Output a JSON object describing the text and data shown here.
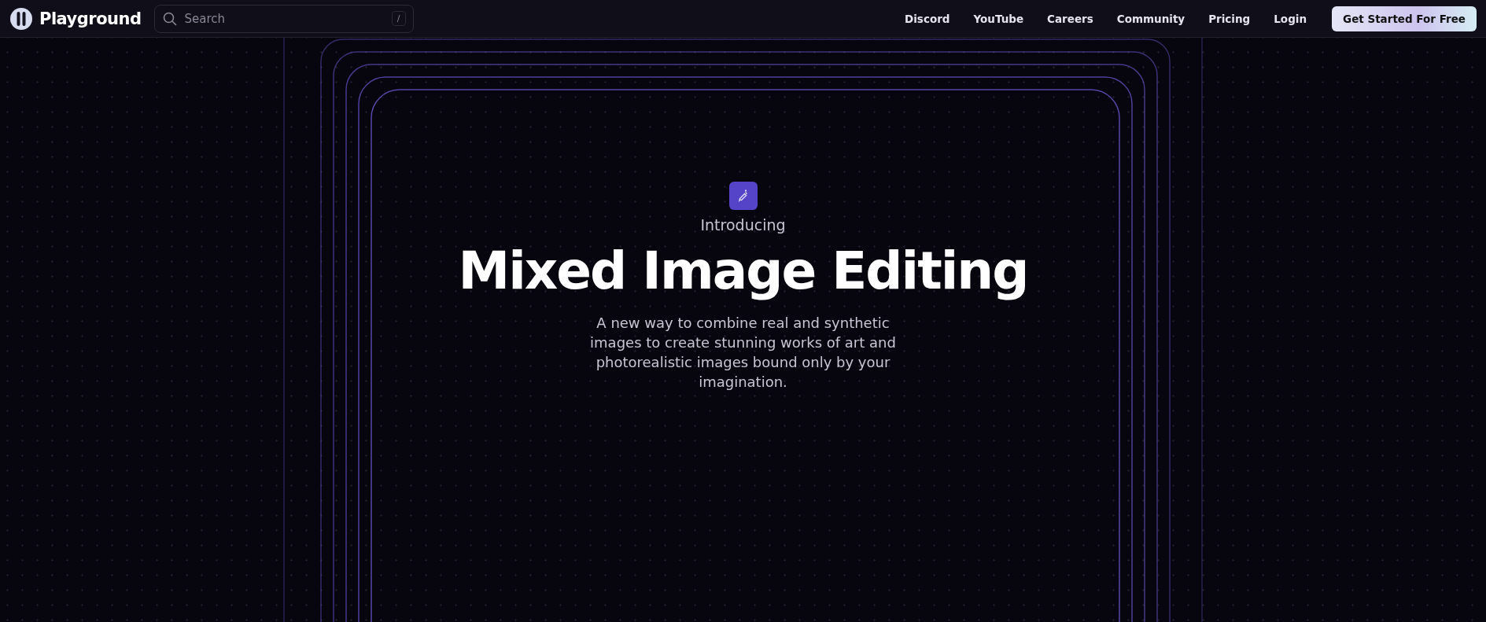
{
  "nav": {
    "brand": "Playground",
    "search": {
      "placeholder": "Search",
      "shortcut": "/"
    },
    "links": [
      "Discord",
      "YouTube",
      "Careers",
      "Community",
      "Pricing",
      "Login"
    ],
    "cta": "Get Started For Free"
  },
  "hero": {
    "eyebrow": "Introducing",
    "title": "Mixed Image Editing",
    "text": "A new way to combine real and synthetic images to create stunning works of art and photorealistic images bound only by your imagination."
  }
}
